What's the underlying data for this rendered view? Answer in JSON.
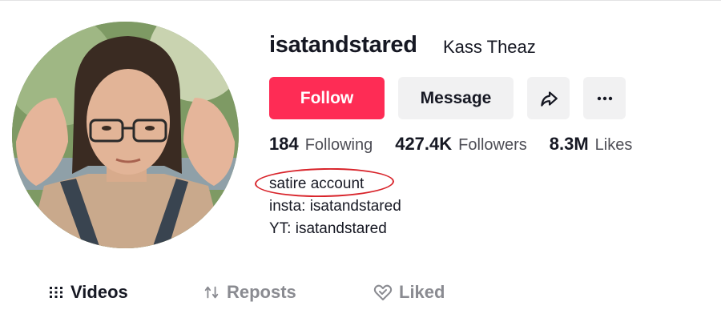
{
  "profile": {
    "username": "isatandstared",
    "nickname": "Kass Theaz"
  },
  "actions": {
    "follow_label": "Follow",
    "message_label": "Message",
    "share_icon": "share-icon",
    "more_icon": "more-icon"
  },
  "stats": {
    "following_count": "184",
    "following_label": "Following",
    "followers_count": "427.4K",
    "followers_label": "Followers",
    "likes_count": "8.3M",
    "likes_label": "Likes"
  },
  "bio": {
    "line1": "satire account",
    "line2": "insta: isatandstared",
    "line3": "YT: isatandstared"
  },
  "tabs": [
    {
      "label": "Videos",
      "icon": "grid-icon",
      "active": true
    },
    {
      "label": "Reposts",
      "icon": "repost-icon",
      "active": false
    },
    {
      "label": "Liked",
      "icon": "liked-heart-icon",
      "active": false
    }
  ],
  "colors": {
    "accent": "#fe2c55",
    "highlight": "#d8232a",
    "secondary_button": "#f1f1f2"
  }
}
